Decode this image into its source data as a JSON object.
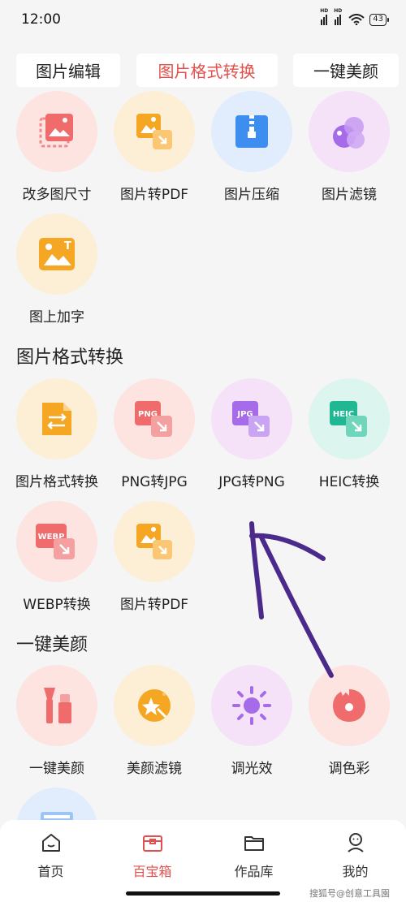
{
  "status": {
    "time": "12:00",
    "battery": "43",
    "network_badge": "HD"
  },
  "top_tabs": [
    {
      "label": "图片编辑",
      "active": false
    },
    {
      "label": "图片格式转换",
      "active": true
    },
    {
      "label": "一键美颜",
      "active": false
    }
  ],
  "tools_row1": [
    {
      "label": "改多图尺寸",
      "icon": "resize-image-icon"
    },
    {
      "label": "图片转PDF",
      "icon": "image-to-pdf-icon"
    },
    {
      "label": "图片压缩",
      "icon": "compress-zip-icon"
    },
    {
      "label": "图片滤镜",
      "icon": "filter-circles-icon"
    }
  ],
  "tools_row2": [
    {
      "label": "图上加字",
      "icon": "add-text-image-icon"
    }
  ],
  "section_format": {
    "title": "图片格式转换",
    "row1": [
      {
        "label": "图片格式转换",
        "icon": "format-convert-icon"
      },
      {
        "label": "PNG转JPG",
        "icon": "png-to-jpg-icon",
        "badge": "PNG"
      },
      {
        "label": "JPG转PNG",
        "icon": "jpg-to-png-icon",
        "badge": "JPG"
      },
      {
        "label": "HEIC转换",
        "icon": "heic-convert-icon",
        "badge": "HEIC"
      }
    ],
    "row2": [
      {
        "label": "WEBP转换",
        "icon": "webp-convert-icon",
        "badge": "WEBP"
      },
      {
        "label": "图片转PDF",
        "icon": "image-to-pdf-icon"
      }
    ]
  },
  "section_beauty": {
    "title": "一键美颜",
    "row1": [
      {
        "label": "一键美颜",
        "icon": "makeup-brush-icon"
      },
      {
        "label": "美颜滤镜",
        "icon": "magic-star-icon"
      },
      {
        "label": "调光效",
        "icon": "sun-icon"
      },
      {
        "label": "调色彩",
        "icon": "palette-icon"
      }
    ]
  },
  "bottom_nav": [
    {
      "label": "首页",
      "icon": "home-icon",
      "active": false
    },
    {
      "label": "百宝箱",
      "icon": "toolbox-icon",
      "active": true
    },
    {
      "label": "作品库",
      "icon": "folder-icon",
      "active": false
    },
    {
      "label": "我的",
      "icon": "profile-icon",
      "active": false
    }
  ],
  "watermark": "搜狐号@创意工具園",
  "colors": {
    "accent": "#e0504c",
    "background": "#f5f5f5",
    "annotation": "#4b2a8c"
  }
}
